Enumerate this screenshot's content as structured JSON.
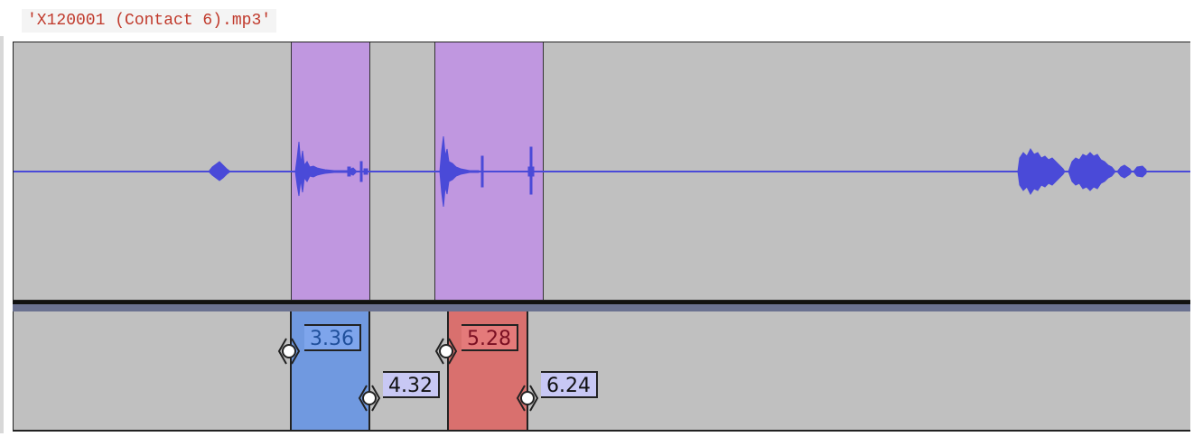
{
  "file": {
    "title": "'X120001 (Contact 6).mp3'"
  },
  "labels": [
    {
      "start": "3.36",
      "end": "4.32",
      "color": "blue"
    },
    {
      "start": "5.28",
      "end": "6.24",
      "color": "red"
    }
  ],
  "colors": {
    "track_bg": "#c0c0c0",
    "selection": "#c097e0",
    "waveform": "#4a4ad8",
    "label_blue": "#7099e0",
    "label_red": "#d9706e",
    "label_box": "#c8c8f4",
    "title_text": "#c0392b"
  }
}
